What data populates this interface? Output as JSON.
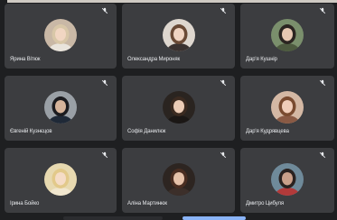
{
  "participants": [
    {
      "name": "Ярина Вітюк",
      "avatar_bg": "#c9b8a6",
      "hair": "#d8c7a8",
      "skin": "#f1d6c2",
      "shirt": "#e9e4dc"
    },
    {
      "name": "Олександра Мироняк",
      "avatar_bg": "#ded7cf",
      "hair": "#6a4a36",
      "skin": "#f0d4c2",
      "shirt": "#3a3230"
    },
    {
      "name": "Дар'я Кушнір",
      "avatar_bg": "#7a8f6c",
      "hair": "#2b2521",
      "skin": "#e7c8b2",
      "shirt": "#4d5a3f"
    },
    {
      "name": "Євгеній Кузнєцов",
      "avatar_bg": "#9aa0a6",
      "hair": "#1b1b1f",
      "skin": "#d6b49b",
      "shirt": "#1f2937"
    },
    {
      "name": "Софія Данилюк",
      "avatar_bg": "#2a2420",
      "hair": "#3b2a20",
      "skin": "#ecccb6",
      "shirt": "#1b1715"
    },
    {
      "name": "Дар'я Кудрявцева",
      "avatar_bg": "#d4b8a4",
      "hair": "#7a4b30",
      "skin": "#f0cdb9",
      "shirt": "#8a5a44"
    },
    {
      "name": "Ірина Бойко",
      "avatar_bg": "#e7d9b0",
      "hair": "#e2c98a",
      "skin": "#f5dcc6",
      "shirt": "#f1e7cf"
    },
    {
      "name": "Аліна Мартинюк",
      "avatar_bg": "#2d2521",
      "hair": "#4a2e22",
      "skin": "#e6c2aa",
      "shirt": "#3c2f2a"
    },
    {
      "name": "Дмитро Цибуля",
      "avatar_bg": "#6f8a9a",
      "hair": "#2a2220",
      "skin": "#caa08a",
      "shirt": "#b23a3a"
    }
  ],
  "colors": {
    "page_bg": "#1e1f21",
    "tile_bg": "#3c3d40",
    "name_text": "#e8eaed",
    "mic_icon": "#e8eaed",
    "accent": "#8ab4f8"
  },
  "icons": {
    "muted": "mic-off-icon"
  }
}
